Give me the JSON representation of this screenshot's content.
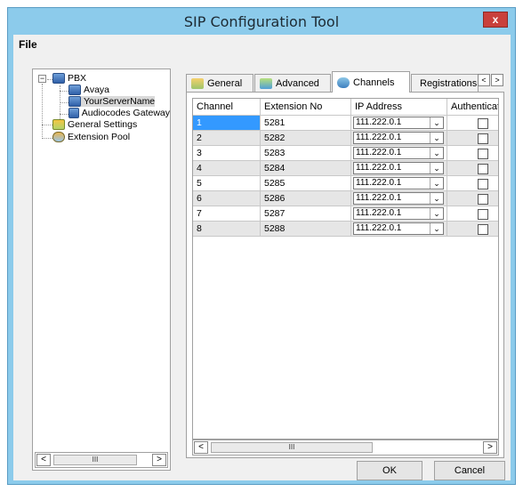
{
  "window": {
    "title": "SIP Configuration Tool",
    "close_glyph": "x"
  },
  "menu": {
    "file": "File"
  },
  "tree": {
    "root": "PBX",
    "children": [
      "Avaya",
      "YourServerName",
      "Audiocodes Gateway"
    ],
    "general_settings": "General Settings",
    "extension_pool": "Extension Pool",
    "expander_glyph": "−"
  },
  "tabs": {
    "general": "General",
    "advanced": "Advanced",
    "channels": "Channels",
    "registrations": "Registrations",
    "scroll_left": "<",
    "scroll_right": ">"
  },
  "grid": {
    "headers": [
      "Channel",
      "Extension No",
      "IP Address",
      "Authentication"
    ],
    "rows": [
      {
        "channel": "1",
        "ext": "5281",
        "ip": "111.222.0.1"
      },
      {
        "channel": "2",
        "ext": "5282",
        "ip": "111.222.0.1"
      },
      {
        "channel": "3",
        "ext": "5283",
        "ip": "111.222.0.1"
      },
      {
        "channel": "4",
        "ext": "5284",
        "ip": "111.222.0.1"
      },
      {
        "channel": "5",
        "ext": "5285",
        "ip": "111.222.0.1"
      },
      {
        "channel": "6",
        "ext": "5286",
        "ip": "111.222.0.1"
      },
      {
        "channel": "7",
        "ext": "5287",
        "ip": "111.222.0.1"
      },
      {
        "channel": "8",
        "ext": "5288",
        "ip": "111.222.0.1"
      }
    ],
    "dropdown_glyph": "⌄"
  },
  "scrollbar": {
    "left": "<",
    "right": ">",
    "thumb": "III"
  },
  "buttons": {
    "ok": "OK",
    "cancel": "Cancel"
  },
  "colors": {
    "frame": "#8ccbeb",
    "selection": "#3399ff",
    "close": "#c9403b"
  }
}
